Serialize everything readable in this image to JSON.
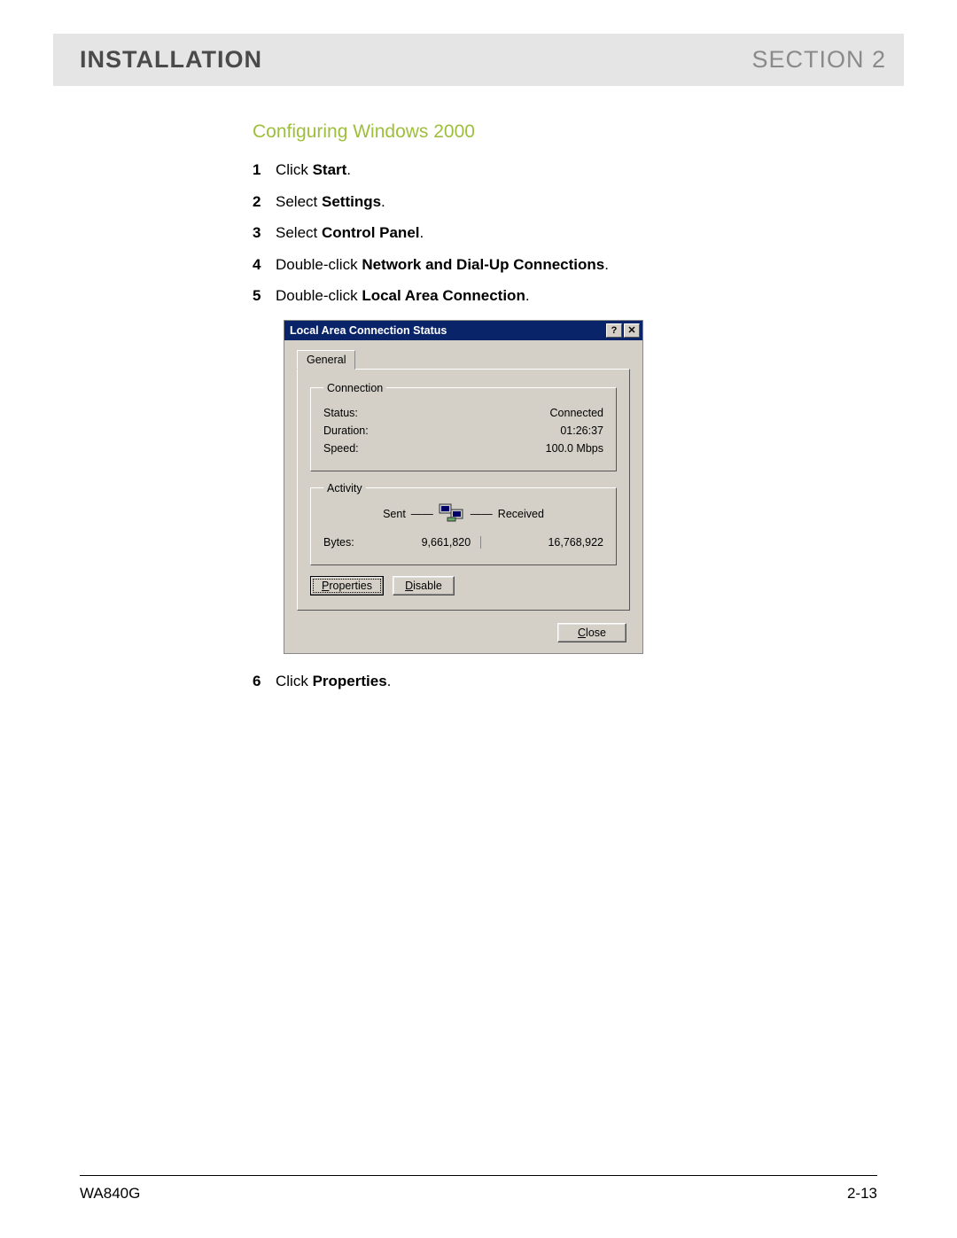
{
  "header": {
    "left": "INSTALLATION",
    "right": "SECTION 2"
  },
  "subhead": "Configuring Windows 2000",
  "steps_a": [
    {
      "n": "1",
      "pre": "Click ",
      "bold": "Start",
      "post": "."
    },
    {
      "n": "2",
      "pre": "Select ",
      "bold": "Settings",
      "post": "."
    },
    {
      "n": "3",
      "pre": "Select ",
      "bold": "Control Panel",
      "post": "."
    },
    {
      "n": "4",
      "pre": "Double-click ",
      "bold": "Network and Dial-Up Connections",
      "post": "."
    },
    {
      "n": "5",
      "pre": "Double-click ",
      "bold": "Local Area Connection",
      "post": "."
    }
  ],
  "steps_b": [
    {
      "n": "6",
      "pre": "Click ",
      "bold": "Properties",
      "post": "."
    }
  ],
  "dialog": {
    "title": "Local Area Connection Status",
    "help_glyph": "?",
    "close_glyph": "✕",
    "tab": "General",
    "connection": {
      "legend": "Connection",
      "status_label": "Status:",
      "status_value": "Connected",
      "duration_label": "Duration:",
      "duration_value": "01:26:37",
      "speed_label": "Speed:",
      "speed_value": "100.0 Mbps"
    },
    "activity": {
      "legend": "Activity",
      "sent": "Sent",
      "received": "Received",
      "bytes_label": "Bytes:",
      "bytes_sent": "9,661,820",
      "bytes_received": "16,768,922"
    },
    "buttons": {
      "properties": "Properties",
      "disable": "Disable",
      "close": "Close"
    }
  },
  "footer": {
    "model": "WA840G",
    "page": "2-13"
  }
}
